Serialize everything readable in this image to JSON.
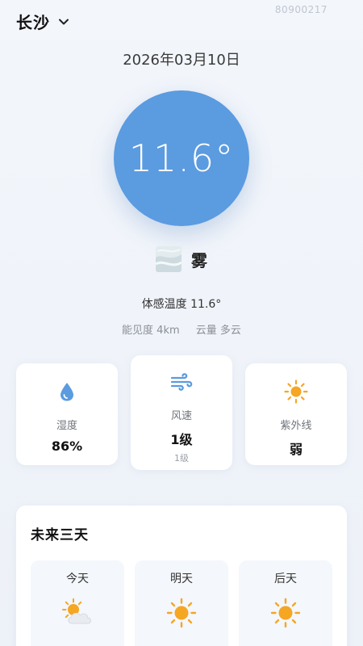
{
  "header": {
    "city": "长沙",
    "watermark": "80900217"
  },
  "date": "2026年03月10日",
  "current": {
    "temperature": "11.6°",
    "condition": "雾",
    "condition_icon": "fog-icon",
    "feels_like": "体感温度 11.6°",
    "visibility": "能见度 4km",
    "cloud": "云量 多云"
  },
  "stats": {
    "humidity": {
      "icon": "water-drop-icon",
      "label": "湿度",
      "value": "86%"
    },
    "wind": {
      "icon": "wind-icon",
      "label": "风速",
      "value": "1级",
      "sub": "1级"
    },
    "uv": {
      "icon": "sun-icon",
      "label": "紫外线",
      "value": "弱"
    }
  },
  "forecast": {
    "title": "未来三天",
    "days": [
      {
        "name": "今天",
        "icon": "partly-cloudy-icon"
      },
      {
        "name": "明天",
        "icon": "sun-icon"
      },
      {
        "name": "后天",
        "icon": "sun-icon"
      }
    ]
  },
  "colors": {
    "accent": "#5b9be0",
    "sun": "#f5a623",
    "drop": "#5b9be0",
    "background": "#eef2f8"
  }
}
